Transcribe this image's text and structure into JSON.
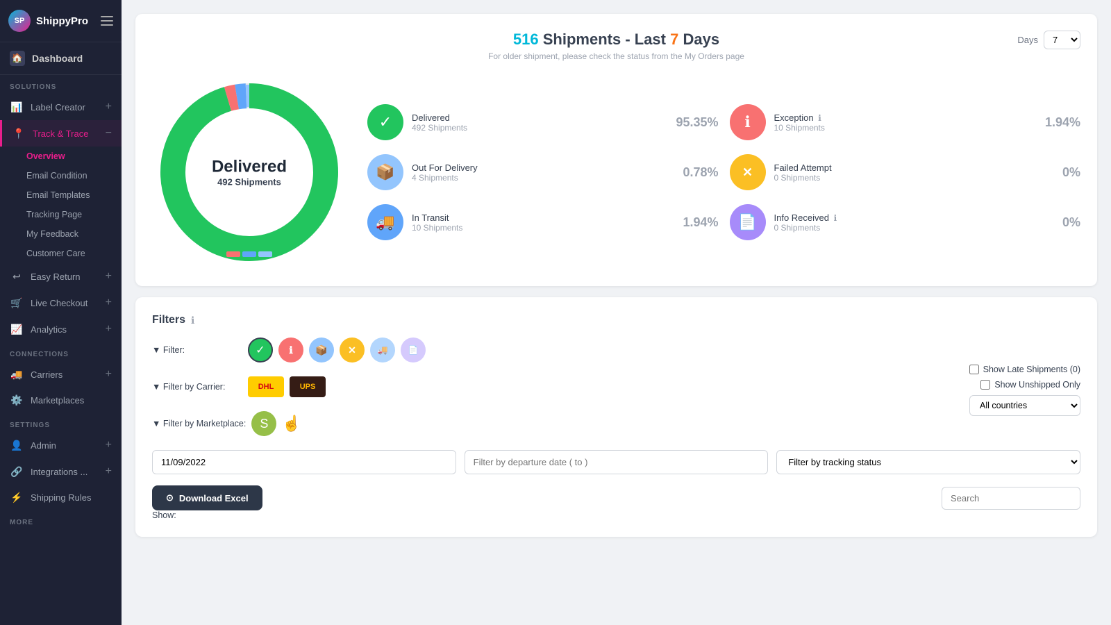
{
  "sidebar": {
    "logo_text": "ShippyPro",
    "dashboard_label": "Dashboard",
    "sections": {
      "solutions": "SOLUTIONS",
      "connections": "CONNECTIONS",
      "settings": "SETTINGS",
      "more": "MORE"
    },
    "items": [
      {
        "id": "label-creator",
        "label": "Label Creator",
        "icon": "📊",
        "expandable": true
      },
      {
        "id": "track-trace",
        "label": "Track & Trace",
        "icon": "📍",
        "expandable": true,
        "active": true
      },
      {
        "id": "easy-return",
        "label": "Easy Return",
        "icon": "↩️",
        "expandable": true
      },
      {
        "id": "live-checkout",
        "label": "Live Checkout",
        "icon": "🛒",
        "expandable": true
      },
      {
        "id": "analytics",
        "label": "Analytics",
        "icon": "📈",
        "expandable": true
      }
    ],
    "track_sub": [
      {
        "id": "overview",
        "label": "Overview",
        "active": true
      },
      {
        "id": "email-condition",
        "label": "Email Condition"
      },
      {
        "id": "email-templates",
        "label": "Email Templates"
      },
      {
        "id": "tracking-page",
        "label": "Tracking Page"
      },
      {
        "id": "my-feedback",
        "label": "My Feedback"
      },
      {
        "id": "customer-care",
        "label": "Customer Care"
      }
    ],
    "connection_items": [
      {
        "id": "carriers",
        "label": "Carriers",
        "icon": "🚚",
        "expandable": true
      },
      {
        "id": "marketplaces",
        "label": "Marketplaces",
        "icon": "⚙️",
        "expandable": false
      }
    ],
    "settings_items": [
      {
        "id": "admin",
        "label": "Admin",
        "icon": "👤",
        "expandable": true
      },
      {
        "id": "integrations",
        "label": "Integrations ...",
        "icon": "🔗",
        "expandable": true
      },
      {
        "id": "shipping-rules",
        "label": "Shipping Rules",
        "icon": "⚡",
        "expandable": false
      }
    ]
  },
  "header": {
    "shipment_count": "516",
    "title_part": "Shipments - Last",
    "days_highlight": "7",
    "title_end": "Days",
    "subtitle": "For older shipment, please check the status from the My Orders page",
    "days_label": "Days",
    "days_value": "7"
  },
  "donut": {
    "center_label": "Delivered",
    "center_sub": "492 Shipments",
    "segments": [
      {
        "label": "Delivered",
        "value": 492,
        "pct": 95.35,
        "color": "#22c55e"
      },
      {
        "label": "In Transit",
        "value": 10,
        "pct": 1.94,
        "color": "#60a5fa"
      },
      {
        "label": "Out For Delivery",
        "value": 4,
        "pct": 0.78,
        "color": "#93c5fd"
      },
      {
        "label": "Exception",
        "value": 10,
        "pct": 1.94,
        "color": "#f87171"
      },
      {
        "label": "Failed Attempt",
        "value": 0,
        "pct": 0,
        "color": "#fbbf24"
      },
      {
        "label": "Info Received",
        "value": 0,
        "pct": 0,
        "color": "#a78bfa"
      }
    ]
  },
  "stats": [
    {
      "id": "delivered",
      "label": "Delivered",
      "count": "492 Shipments",
      "pct": "95.35%",
      "icon_class": "green",
      "icon": "✓"
    },
    {
      "id": "out-for-delivery",
      "label": "Out For Delivery",
      "count": "4 Shipments",
      "pct": "0.78%",
      "icon_class": "blue-light",
      "icon": "📦"
    },
    {
      "id": "in-transit",
      "label": "In Transit",
      "count": "10 Shipments",
      "pct": "1.94%",
      "icon_class": "blue",
      "icon": "🚚"
    },
    {
      "id": "exception",
      "label": "Exception",
      "count": "10 Shipments",
      "pct": "1.94%",
      "icon_class": "red",
      "icon": "ℹ"
    },
    {
      "id": "failed-attempt",
      "label": "Failed Attempt",
      "count": "0 Shipments",
      "pct": "0%",
      "icon_class": "yellow",
      "icon": "✕"
    },
    {
      "id": "info-received",
      "label": "Info Received",
      "count": "0 Shipments",
      "pct": "0%",
      "icon_class": "purple",
      "icon": "📄"
    }
  ],
  "filters": {
    "title": "Filters",
    "filter_label": "▼ Filter:",
    "carrier_label": "▼ Filter by Carrier:",
    "marketplace_label": "▼ Filter by Marketplace:",
    "show_late_label": "Show Late Shipments (0)",
    "show_unshipped_label": "Show Unshipped Only",
    "all_countries": "All countries",
    "date_from": "11/09/2022",
    "date_to_placeholder": "Filter by departure date ( to )",
    "tracking_status_placeholder": "Filter by tracking status",
    "download_label": "Download Excel",
    "search_placeholder": "Search",
    "show_label": "Show:"
  }
}
